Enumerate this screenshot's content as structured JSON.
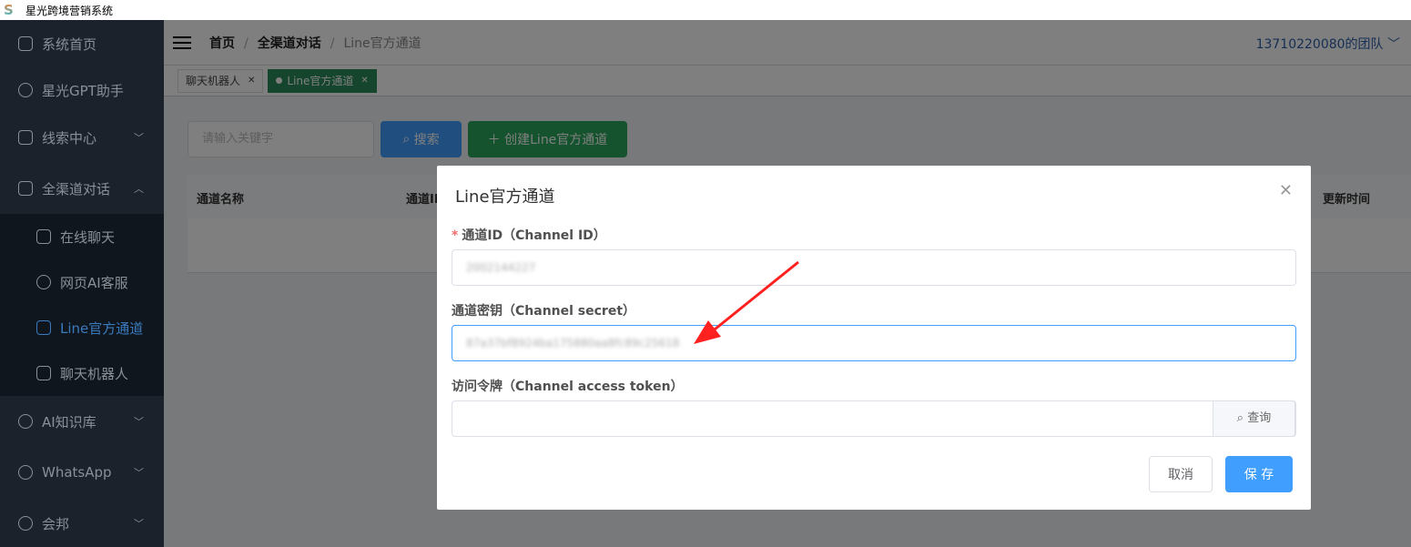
{
  "app": {
    "title": "星光跨境营销系统"
  },
  "sidebar": {
    "items": [
      {
        "label": "系统首页",
        "icon": "home-icon"
      },
      {
        "label": "星光GPT助手",
        "icon": "openai-icon"
      },
      {
        "label": "线索中心",
        "icon": "search-icon",
        "expandable": true
      },
      {
        "label": "全渠道对话",
        "icon": "chat-icon",
        "expandable": true,
        "expanded": true
      },
      {
        "label": "AI知识库",
        "icon": "brain-icon",
        "expandable": true
      },
      {
        "label": "WhatsApp",
        "icon": "whatsapp-icon",
        "expandable": true
      },
      {
        "label": "会邦",
        "icon": "bulb-icon",
        "expandable": true
      }
    ],
    "sub_items": [
      {
        "label": "在线聊天",
        "icon": "chat-icon"
      },
      {
        "label": "网页AI客服",
        "icon": "headset-icon"
      },
      {
        "label": "Line官方通道",
        "icon": "line-icon",
        "active": true
      },
      {
        "label": "聊天机器人",
        "icon": "robot-icon"
      }
    ]
  },
  "header": {
    "breadcrumb": [
      "首页",
      "全渠道对话",
      "Line官方通道"
    ],
    "team": "13710220080的团队"
  },
  "tabs": [
    {
      "label": "聊天机器人",
      "active": false
    },
    {
      "label": "Line官方通道",
      "active": true
    }
  ],
  "toolbar": {
    "search_placeholder": "请输入关键字",
    "search_label": "搜索",
    "create_label": "创建Line官方通道"
  },
  "table": {
    "columns": [
      "通道名称",
      "通道ID",
      "更新时间"
    ]
  },
  "modal": {
    "title": "Line官方通道",
    "fields": [
      {
        "label": "通道ID（Channel ID）",
        "required": true,
        "value": "2002144227"
      },
      {
        "label": "通道密钥（Channel secret）",
        "required": false,
        "value": "87a37bf8924ba175880aa8fc89c25618"
      },
      {
        "label": "访问令牌（Channel access token）",
        "required": false,
        "value": "",
        "append_label": "查询"
      }
    ],
    "cancel_label": "取消",
    "save_label": "保 存"
  },
  "colors": {
    "primary": "#409eff",
    "success": "#2a9a5c",
    "sidebar": "#1b222c",
    "annotation_arrow": "#ff2020"
  }
}
